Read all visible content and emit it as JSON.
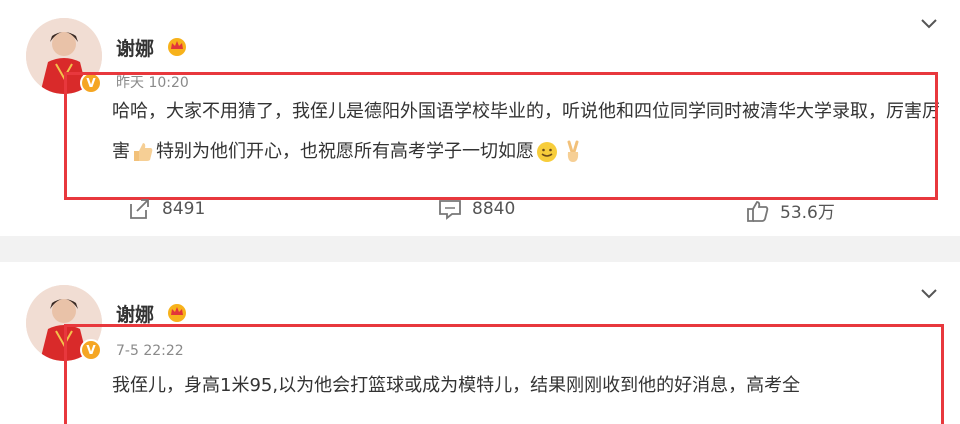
{
  "posts": [
    {
      "author": "谢娜",
      "verified_mark": "V",
      "time": "昨天 10:20",
      "content_a": "哈哈，大家不用猜了，我侄儿是德阳外国语学校毕业的，听说他和四位同学同时被清华大学录取，厉害厉害",
      "content_b": "特别为他们开心，也祝愿所有高考学子一切如愿",
      "icons": [
        "thumbs-up-emoji",
        "smile-emoji",
        "victory-hand-emoji"
      ],
      "actions": {
        "repost": "8491",
        "comment": "8840",
        "like": "53.6万"
      }
    },
    {
      "author": "谢娜",
      "verified_mark": "V",
      "time": "7-5 22:22",
      "content": "我侄儿，身高1米95,以为他会打篮球或成为模特儿，结果刚刚收到他的好消息，高考全"
    }
  ],
  "colors": {
    "highlight_box": "#e8383d",
    "verified_badge": "#f5a623",
    "background": "#ffffff",
    "divider": "#f2f2f2"
  }
}
